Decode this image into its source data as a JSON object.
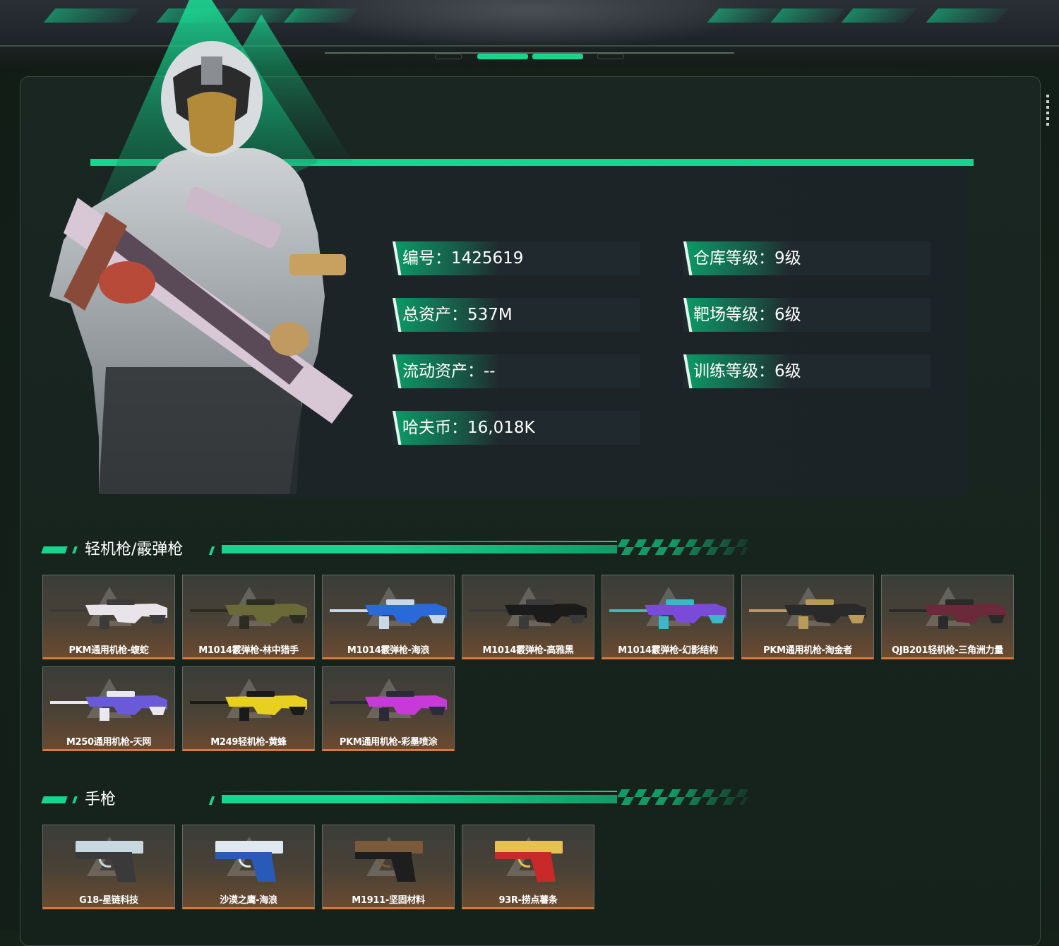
{
  "profile": {
    "stats_left": [
      {
        "label": "编号：1425619"
      },
      {
        "label": "总资产：537M"
      },
      {
        "label": "流动资产：--"
      },
      {
        "label": "哈夫币：16,018K"
      }
    ],
    "stats_right": [
      {
        "label": "仓库等级：9级"
      },
      {
        "label": "靶场等级：6级"
      },
      {
        "label": "训练等级：6级"
      }
    ]
  },
  "sections": {
    "lmg": {
      "title": "轻机枪/霰弹枪",
      "items": [
        {
          "name": "PKM通用机枪-蝮蛇",
          "colors": [
            "#e8e4ea",
            "#3b3b3b"
          ]
        },
        {
          "name": "M1014霰弹枪-林中猎手",
          "colors": [
            "#6a6a38",
            "#2c2c22"
          ]
        },
        {
          "name": "M1014霰弹枪-海浪",
          "colors": [
            "#2a6ad8",
            "#c8d8e8"
          ]
        },
        {
          "name": "M1014霰弹枪-高雅黑",
          "colors": [
            "#1b1b1b",
            "#3a3a3a"
          ]
        },
        {
          "name": "M1014霰弹枪-幻影结构",
          "colors": [
            "#7a4ad8",
            "#3ab8c8"
          ]
        },
        {
          "name": "PKM通用机枪-淘金者",
          "colors": [
            "#2a2a2a",
            "#b89a5a"
          ]
        },
        {
          "name": "QJB201轻机枪-三角洲力量",
          "colors": [
            "#6a2a3a",
            "#2a2a2a"
          ]
        },
        {
          "name": "M250通用机枪-天网",
          "colors": [
            "#6a5ad8",
            "#e8e8f0"
          ]
        },
        {
          "name": "M249轻机枪-黄蜂",
          "colors": [
            "#e8d020",
            "#1a1a1a"
          ]
        },
        {
          "name": "PKM通用机枪-彩墨喷涂",
          "colors": [
            "#c83ad8",
            "#2a2a3a"
          ]
        }
      ]
    },
    "pistol": {
      "title": "手枪",
      "items": [
        {
          "name": "G18-星链科技",
          "colors": [
            "#3a3a3a",
            "#c8d8e0"
          ]
        },
        {
          "name": "沙漠之鹰-海浪",
          "colors": [
            "#2a5ab8",
            "#dfe8ee"
          ]
        },
        {
          "name": "M1911-坚固材料",
          "colors": [
            "#1e1e1e",
            "#7a5a3a"
          ]
        },
        {
          "name": "93R-捞点薯条",
          "colors": [
            "#c82a2a",
            "#e8c050"
          ]
        }
      ]
    }
  },
  "theme": {
    "accent": "#17d48e",
    "card_border_bottom": "#d97a38"
  }
}
